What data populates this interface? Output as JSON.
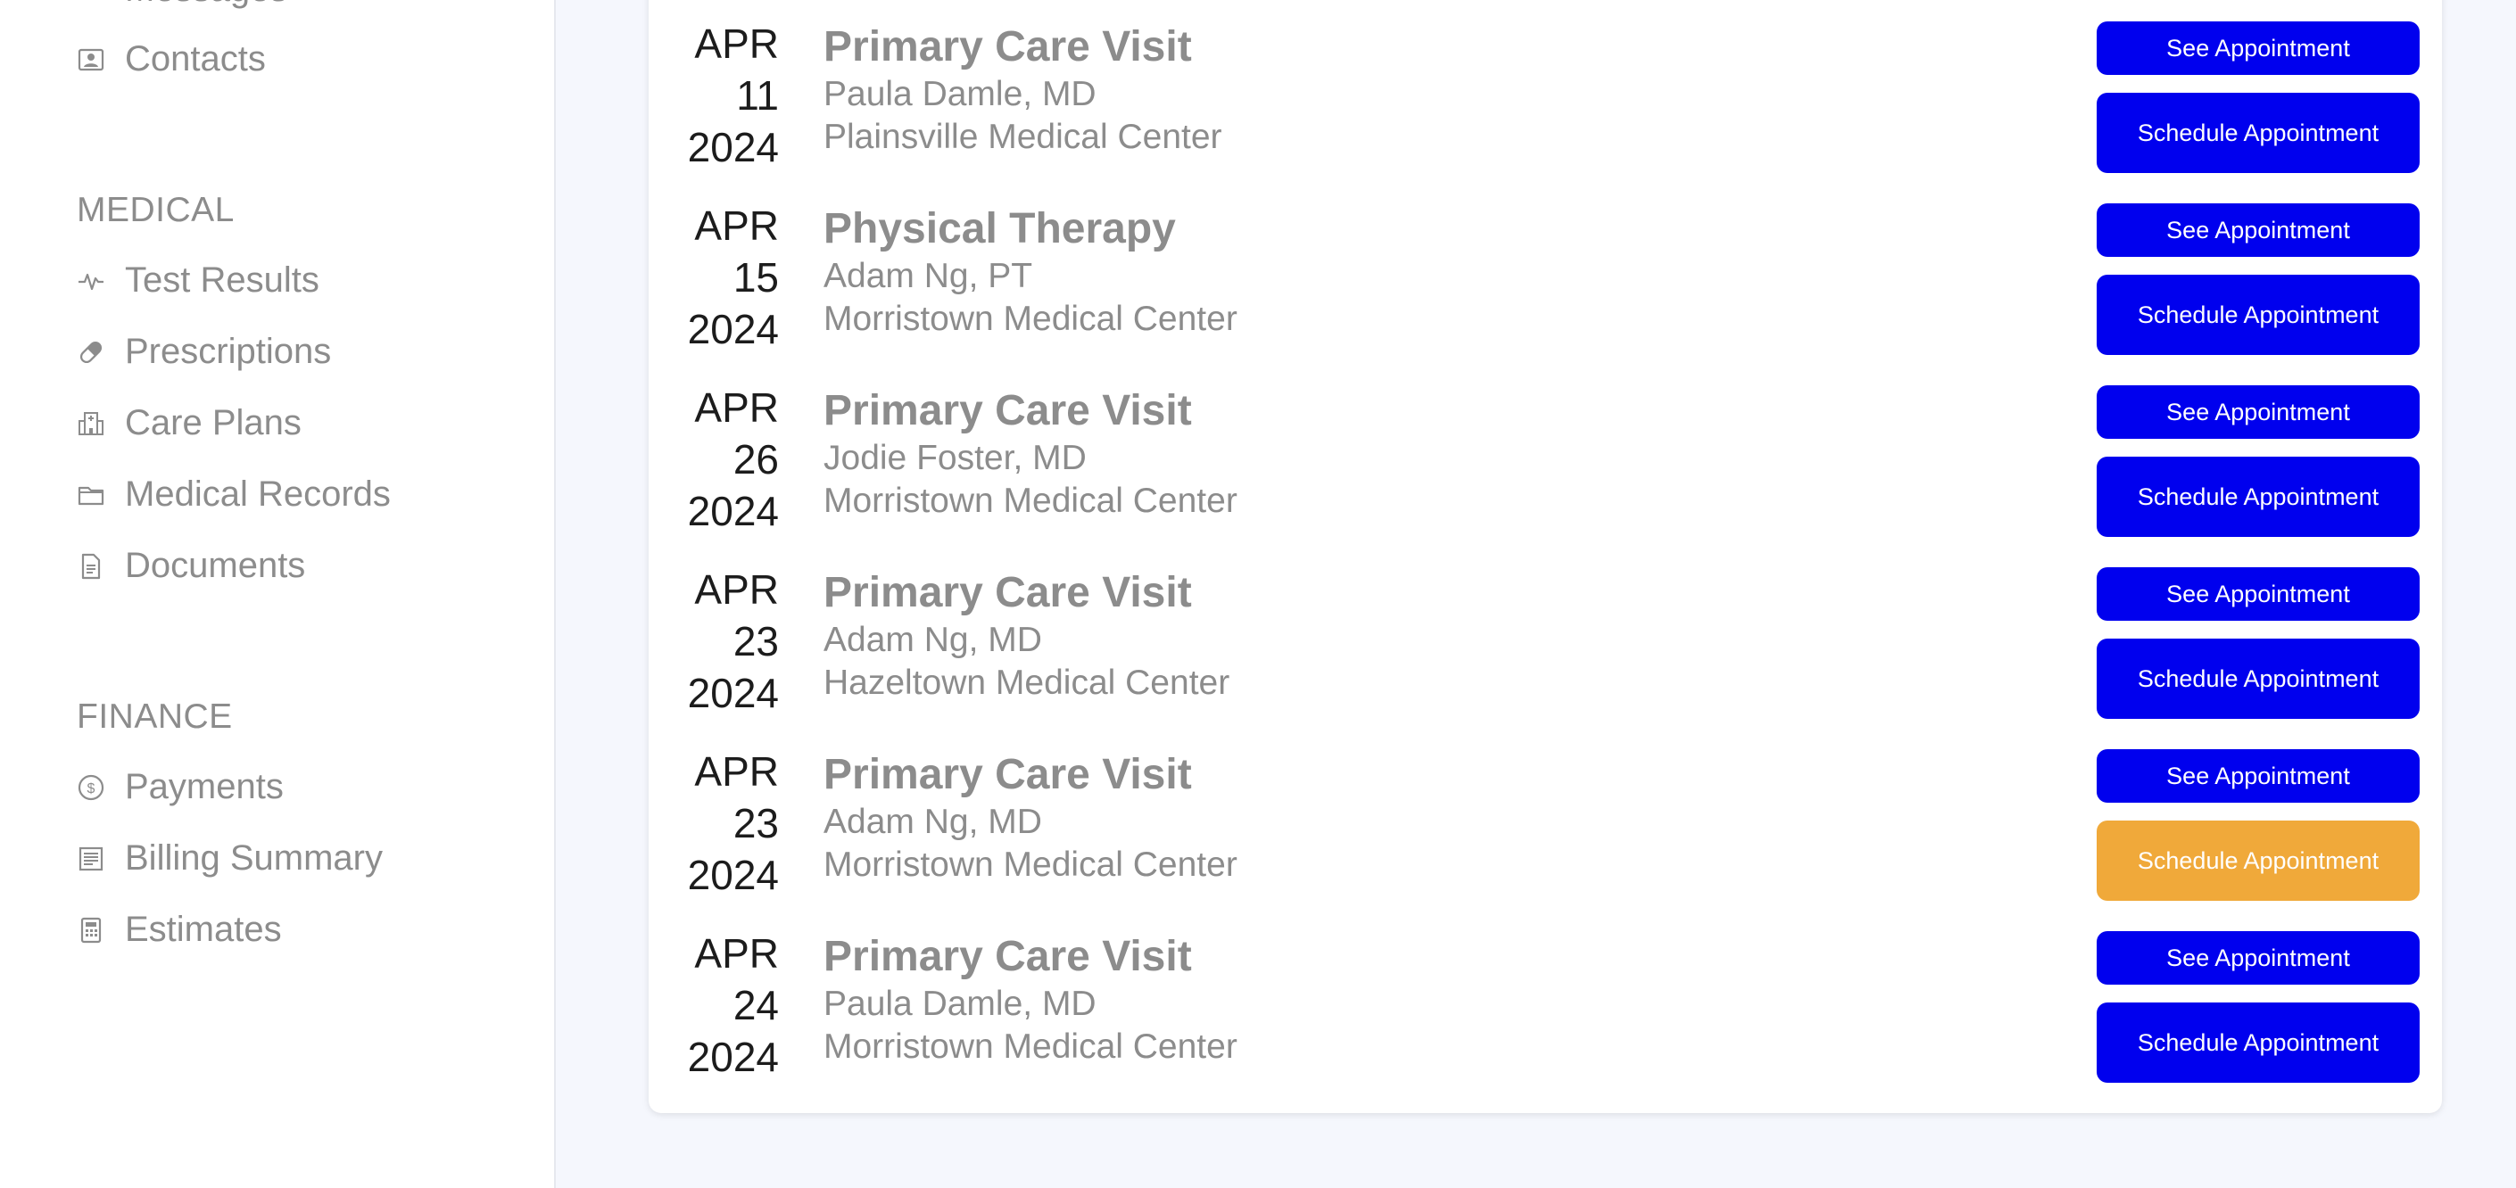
{
  "sidebar": {
    "partial_item": "Messages",
    "contacts": "Contacts",
    "medical": {
      "title": "MEDICAL",
      "items": [
        "Test Results",
        "Prescriptions",
        "Care Plans",
        "Medical Records",
        "Documents"
      ]
    },
    "finance": {
      "title": "FINANCE",
      "items": [
        "Payments",
        "Billing Summary",
        "Estimates"
      ]
    }
  },
  "appointments": [
    {
      "month": "APR",
      "day": "11",
      "year": "2024",
      "title": "Primary Care Visit",
      "provider": "Paula Damle, MD",
      "location": "Plainsville Medical Center",
      "see_label": "See Appointment",
      "schedule_label": "Schedule Appointment"
    },
    {
      "month": "APR",
      "day": "15",
      "year": "2024",
      "title": "Physical Therapy",
      "provider": "Adam Ng, PT",
      "location": "Morristown Medical Center",
      "see_label": "See Appointment",
      "schedule_label": "Schedule Appointment"
    },
    {
      "month": "APR",
      "day": "26",
      "year": "2024",
      "title": "Primary Care Visit",
      "provider": "Jodie Foster, MD",
      "location": "Morristown Medical Center",
      "see_label": "See Appointment",
      "schedule_label": "Schedule Appointment"
    },
    {
      "month": "APR",
      "day": "23",
      "year": "2024",
      "title": "Primary Care Visit",
      "provider": "Adam Ng, MD",
      "location": "Hazeltown Medical Center",
      "see_label": "See Appointment",
      "schedule_label": "Schedule Appointment"
    },
    {
      "month": "APR",
      "day": "23",
      "year": "2024",
      "title": "Primary Care Visit",
      "provider": "Adam Ng, MD",
      "location": "Morristown Medical Center",
      "see_label": "See Appointment",
      "schedule_label": "Schedule Appointment",
      "highlighted": true
    },
    {
      "month": "APR",
      "day": "24",
      "year": "2024",
      "title": "Primary Care Visit",
      "provider": "Paula Damle, MD",
      "location": "Morristown Medical Center",
      "see_label": "See Appointment",
      "schedule_label": "Schedule Appointment"
    }
  ],
  "colors": {
    "primary_button": "#0000ee",
    "highlight_button": "#f0a93a",
    "background": "#f5f7fd"
  },
  "icons": {
    "contacts": "contacts-icon",
    "test_results": "pulse-icon",
    "prescriptions": "pill-icon",
    "care_plans": "hospital-icon",
    "medical_records": "folder-icon",
    "documents": "document-icon",
    "payments": "dollar-coin-icon",
    "billing_summary": "receipt-icon",
    "estimates": "calculator-icon"
  }
}
